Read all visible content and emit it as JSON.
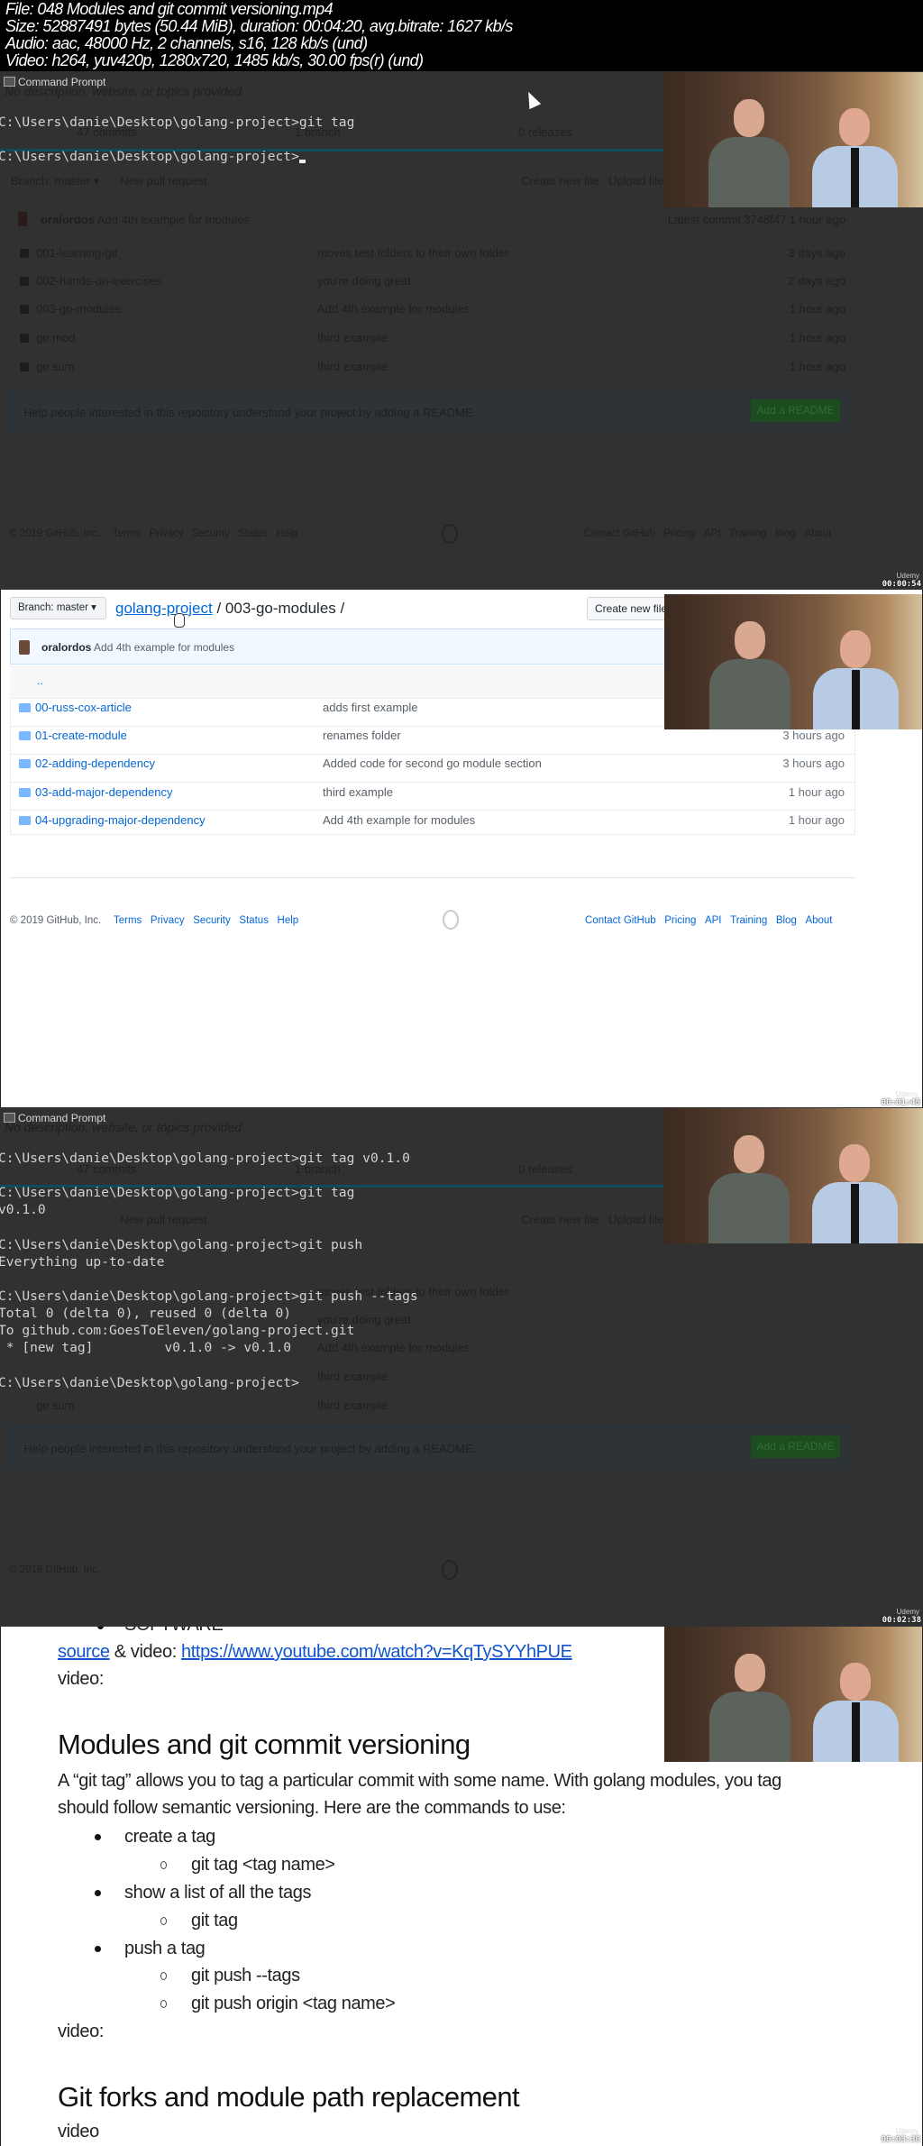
{
  "file_info": {
    "file": "File: 048 Modules and git commit versioning.mp4",
    "size": "Size: 52887491 bytes (50.44 MiB), duration: 00:04:20, avg.bitrate: 1627 kb/s",
    "audio": "Audio: aac, 48000 Hz, 2 channels, s16, 128 kb/s (und)",
    "video": "Video: h264, yuv420p, 1280x720, 1485 kb/s, 30.00 fps(r) (und)"
  },
  "ghost_repo": {
    "description": "No description, website, or topics provided",
    "commits": "47 commits",
    "branches": "1 branch",
    "releases": "0 releases",
    "branch_button": "Branch: master ▾",
    "new_pull_request": "New pull request",
    "create_new_file": "Create new file",
    "upload_files": "Upload files",
    "commit_author": "oralordos",
    "commit_message": "Add 4th example for modules",
    "latest_commit": "Latest commit 3748f47 1 hour ago",
    "rows": [
      {
        "name": "001-learning-git",
        "message": "moves test folders to their own folder",
        "age": "3 days ago"
      },
      {
        "name": "002-hands-on-exercises",
        "message": "you're doing great",
        "age": "2 days ago"
      },
      {
        "name": "003-go-modules",
        "message": "Add 4th example for modules",
        "age": "1 hour ago"
      },
      {
        "name": "go.mod",
        "message": "third example",
        "age": "1 hour ago"
      },
      {
        "name": "go.sum",
        "message": "third example",
        "age": "1 hour ago"
      }
    ],
    "readme_prompt": "Help people interested in this repository understand your project by adding a README.",
    "add_readme": "Add a README"
  },
  "footer": {
    "copyright": "© 2019 GitHub, Inc.",
    "left_links": [
      "Terms",
      "Privacy",
      "Security",
      "Status",
      "Help"
    ],
    "right_links": [
      "Contact GitHub",
      "Pricing",
      "API",
      "Training",
      "Blog",
      "About"
    ]
  },
  "frame1": {
    "window_title": "Command Prompt",
    "lines": [
      "C:\\Users\\danie\\Desktop\\golang-project>git tag",
      "C:\\Users\\danie\\Desktop\\golang-project>"
    ],
    "timestamp": "00:00:54"
  },
  "frame2": {
    "branch_button": "Branch: master ▾",
    "breadcrumb_repo": "golang-project",
    "breadcrumb_rest": " / 003-go-modules /",
    "create_new_file": "Create new file",
    "commit_author": "oralordos",
    "commit_message": "Add 4th example for modules",
    "parent_dir": "..",
    "rows": [
      {
        "name": "00-russ-cox-article",
        "message": "adds first example",
        "age": ""
      },
      {
        "name": "01-create-module",
        "message": "renames folder",
        "age": "3 hours ago"
      },
      {
        "name": "02-adding-dependency",
        "message": "Added code for second go module section",
        "age": "3 hours ago"
      },
      {
        "name": "03-add-major-dependency",
        "message": "third example",
        "age": "1 hour ago"
      },
      {
        "name": "04-upgrading-major-dependency",
        "message": "Add 4th example for modules",
        "age": "1 hour ago"
      }
    ],
    "timestamp": "00:01:45"
  },
  "frame3": {
    "window_title": "Command Prompt",
    "lines": [
      "C:\\Users\\danie\\Desktop\\golang-project>git tag v0.1.0",
      "C:\\Users\\danie\\Desktop\\golang-project>git tag",
      "v0.1.0",
      "C:\\Users\\danie\\Desktop\\golang-project>git push",
      "Everything up-to-date",
      "C:\\Users\\danie\\Desktop\\golang-project>git push --tags",
      "Total 0 (delta 0), reused 0 (delta 0)",
      "To github.com:GoesToEleven/golang-project.git",
      " * [new tag]         v0.1.0 -> v0.1.0",
      "C:\\Users\\danie\\Desktop\\golang-project>"
    ],
    "timestamp": "00:02:38"
  },
  "frame4": {
    "cut_bullet": "SOFTWARE",
    "source_link": "source",
    "source_mid": " & video: ",
    "video_url": "https://www.youtube.com/watch?v=KqTySYYhPUE",
    "video_label_1": "video:",
    "heading": "Modules and git commit versioning",
    "paragraph_1": "A “git tag” allows you to tag a particular commit with some name. With golang modules, you tag",
    "paragraph_2": "should follow semantic versioning. Here are the commands to use:",
    "bullets": [
      {
        "text": "create a tag",
        "sub": [
          "git tag <tag name>"
        ]
      },
      {
        "text": "show a list of all the tags",
        "sub": [
          "git tag"
        ]
      },
      {
        "text": "push a tag",
        "sub": [
          "git push --tags",
          "git push origin <tag name>"
        ]
      }
    ],
    "video_label_2": "video:",
    "heading_2": "Git forks and module path replacement",
    "video_label_3": "video",
    "timestamp": "00:03:30"
  },
  "watermark": "Udemy",
  "colors": {
    "link": "#0366d6",
    "terminal_bg": "#313131",
    "highlight": "#0e4b5c",
    "readme_button": "#1b4d1f"
  }
}
